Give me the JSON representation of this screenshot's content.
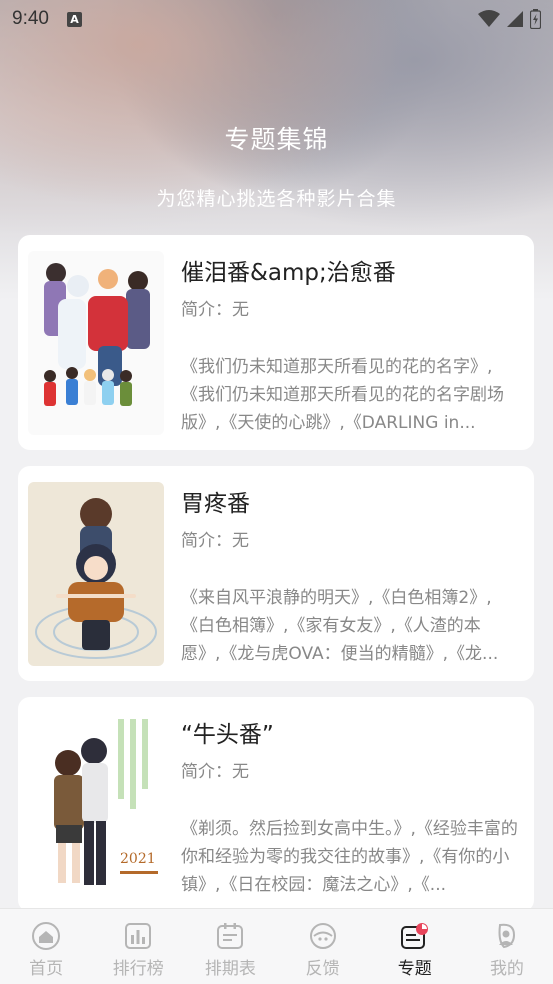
{
  "status": {
    "time": "9:40",
    "notification_badge": "A"
  },
  "header": {
    "title": "专题集锦",
    "subtitle": "为您精心挑选各种影片合集"
  },
  "collections": [
    {
      "title": "催泪番&amp;治愈番",
      "intro": "简介：无",
      "desc": "《我们仍未知道那天所看见的花的名字》,《我们仍未知道那天所看见的花的名字剧场版》,《天使的心跳》,《DARLING in..."
    },
    {
      "title": "胃疼番",
      "intro": "简介：无",
      "desc": "《来自风平浪静的明天》,《白色相簿2》,《白色相簿》,《家有女友》,《人渣的本愿》,《龙与虎OVA：便当的精髓》,《龙..."
    },
    {
      "title": "“牛头番”",
      "intro": "简介：无",
      "desc": "《剃须。然后捡到女高中生。》,《经验丰富的你和经验为零的我交往的故事》,《有你的小镇》,《日在校园：魔法之心》,《..."
    }
  ],
  "tabs": [
    {
      "label": "首页",
      "icon": "home-icon",
      "active": false
    },
    {
      "label": "排行榜",
      "icon": "ranking-icon",
      "active": false
    },
    {
      "label": "排期表",
      "icon": "schedule-icon",
      "active": false
    },
    {
      "label": "反馈",
      "icon": "feedback-icon",
      "active": false
    },
    {
      "label": "专题",
      "icon": "topics-icon",
      "active": true
    },
    {
      "label": "我的",
      "icon": "profile-icon",
      "active": false
    }
  ],
  "colors": {
    "active_tab": "#222222",
    "inactive_tab": "#b5b5b5",
    "accent": "#e8455b"
  }
}
